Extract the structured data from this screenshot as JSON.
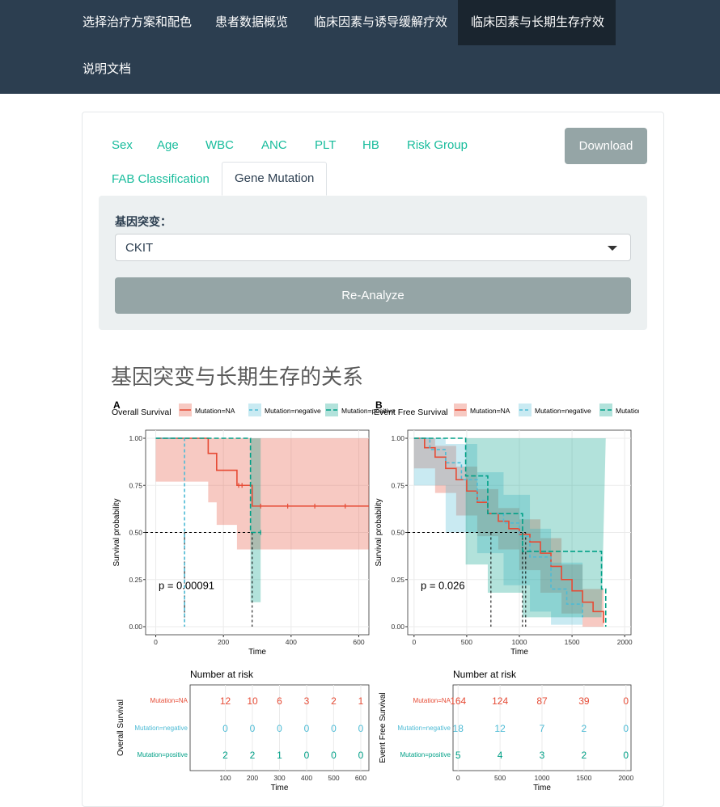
{
  "nav": {
    "items": [
      {
        "label": "选择治疗方案和配色"
      },
      {
        "label": "患者数据概览"
      },
      {
        "label": "临床因素与诱导缓解疗效"
      },
      {
        "label": "临床因素与长期生存疗效"
      },
      {
        "label": "说明文档"
      }
    ],
    "active_index": 3
  },
  "tabs": [
    {
      "label": "Sex"
    },
    {
      "label": "Age"
    },
    {
      "label": "WBC"
    },
    {
      "label": "ANC"
    },
    {
      "label": "PLT"
    },
    {
      "label": "HB"
    },
    {
      "label": "Risk Group"
    },
    {
      "label": "FAB Classification"
    },
    {
      "label": "Gene Mutation"
    }
  ],
  "active_tab": "Gene Mutation",
  "download_label": "Download",
  "form": {
    "gene_label": "基因突变：",
    "gene_selected": "CKIT",
    "reanalyze_label": "Re-Analyze"
  },
  "section_title": "基因突变与长期生存的关系",
  "colors": {
    "navbar": "#2c3e50",
    "accent": "#18bc9c",
    "button": "#95a5a6",
    "well": "#ecf0f1",
    "na": "#e64b35",
    "negative": "#4dbbd5",
    "positive": "#00a087"
  },
  "chart_data": [
    {
      "type": "line",
      "panel_label": "A",
      "title": "Overall Survival",
      "legend": [
        "Mutation=NA",
        "Mutation=negative",
        "Mutation=positive"
      ],
      "legend_position": "top",
      "xlabel": "Time",
      "ylabel": "Survival probability",
      "xlim": [
        -30,
        630
      ],
      "ylim": [
        0,
        1
      ],
      "x_ticks": [
        0,
        200,
        400,
        600
      ],
      "y_ticks": [
        0.0,
        0.25,
        0.5,
        0.75,
        1.0
      ],
      "y_tick_labels": [
        "0.00",
        "0.25",
        "0.50",
        "0.75",
        "1.00"
      ],
      "pvalue": "p = 0.00091",
      "median_lines": [
        85,
        285
      ],
      "series": [
        {
          "name": "Mutation=NA",
          "steps": [
            [
              0,
              1.0
            ],
            [
              155,
              0.92
            ],
            [
              180,
              0.83
            ],
            [
              240,
              0.75
            ],
            [
              285,
              0.64
            ],
            [
              630,
              0.64
            ]
          ],
          "ci_lower": [
            [
              0,
              1.0
            ],
            [
              155,
              0.77
            ],
            [
              180,
              0.66
            ],
            [
              240,
              0.54
            ],
            [
              285,
              0.41
            ],
            [
              630,
              0.41
            ]
          ],
          "ci_upper": [
            [
              0,
              1.0
            ],
            [
              630,
              1.0
            ]
          ],
          "censor": [
            [
              245,
              0.75
            ],
            [
              255,
              0.75
            ],
            [
              310,
              0.64
            ],
            [
              390,
              0.64
            ],
            [
              470,
              0.64
            ],
            [
              560,
              0.64
            ]
          ]
        },
        {
          "name": "Mutation=negative",
          "steps": [
            [
              0,
              1.0
            ],
            [
              85,
              1.0
            ],
            [
              85,
              0.0
            ]
          ],
          "ci_lower": [],
          "ci_upper": [],
          "censor": []
        },
        {
          "name": "Mutation=positive",
          "steps": [
            [
              0,
              1.0
            ],
            [
              280,
              1.0
            ],
            [
              280,
              0.5
            ],
            [
              310,
              0.5
            ]
          ],
          "ci_lower": [
            [
              280,
              0.13
            ],
            [
              310,
              0.13
            ]
          ],
          "ci_upper": [
            [
              280,
              1.0
            ],
            [
              310,
              1.0
            ]
          ],
          "censor": [
            [
              310,
              0.5
            ]
          ]
        }
      ],
      "risk_table": {
        "title": "Number at risk",
        "ylabel": "Overall Survival",
        "x_ticks": [
          100,
          200,
          300,
          400,
          500,
          600
        ],
        "xlabel": "Time",
        "rows": [
          {
            "name": "Mutation=NA",
            "values": [
              12,
              10,
              6,
              3,
              2,
              1
            ]
          },
          {
            "name": "Mutation=negative",
            "values": [
              0,
              0,
              0,
              0,
              0,
              0
            ]
          },
          {
            "name": "Mutation=positive",
            "values": [
              2,
              2,
              1,
              0,
              0,
              0
            ]
          }
        ]
      }
    },
    {
      "type": "line",
      "panel_label": "B",
      "title": "Event Free Survival",
      "legend": [
        "Mutation=NA",
        "Mutation=negative",
        "Mutation=positive"
      ],
      "legend_position": "top",
      "xlabel": "Time",
      "ylabel": "Survival probability",
      "xlim": [
        -60,
        2060
      ],
      "ylim": [
        0,
        1
      ],
      "x_ticks": [
        0,
        500,
        1000,
        1500,
        2000
      ],
      "y_ticks": [
        0.0,
        0.25,
        0.5,
        0.75,
        1.0
      ],
      "y_tick_labels": [
        "0.00",
        "0.25",
        "0.50",
        "0.75",
        "1.00"
      ],
      "pvalue": "p = 0.026",
      "median_lines": [
        730,
        1030,
        1060
      ],
      "series": [
        {
          "name": "Mutation=NA",
          "steps": [
            [
              0,
              1.0
            ],
            [
              100,
              0.95
            ],
            [
              200,
              0.9
            ],
            [
              300,
              0.84
            ],
            [
              400,
              0.78
            ],
            [
              500,
              0.72
            ],
            [
              600,
              0.66
            ],
            [
              700,
              0.6
            ],
            [
              800,
              0.56
            ],
            [
              900,
              0.52
            ],
            [
              1000,
              0.49
            ],
            [
              1100,
              0.45
            ],
            [
              1200,
              0.39
            ],
            [
              1300,
              0.32
            ],
            [
              1400,
              0.25
            ],
            [
              1500,
              0.19
            ],
            [
              1600,
              0.13
            ],
            [
              1700,
              0.08
            ],
            [
              1800,
              0.02
            ]
          ],
          "ci_lower": [
            [
              0,
              1.0
            ],
            [
              200,
              0.84
            ],
            [
              400,
              0.71
            ],
            [
              600,
              0.59
            ],
            [
              800,
              0.48
            ],
            [
              1000,
              0.41
            ],
            [
              1200,
              0.3
            ],
            [
              1400,
              0.18
            ],
            [
              1600,
              0.07
            ],
            [
              1800,
              0.0
            ]
          ],
          "ci_upper": [
            [
              0,
              1.0
            ],
            [
              200,
              0.96
            ],
            [
              400,
              0.85
            ],
            [
              600,
              0.73
            ],
            [
              800,
              0.63
            ],
            [
              1000,
              0.57
            ],
            [
              1200,
              0.47
            ],
            [
              1400,
              0.33
            ],
            [
              1600,
              0.2
            ],
            [
              1800,
              0.06
            ]
          ],
          "censor": []
        },
        {
          "name": "Mutation=negative",
          "steps": [
            [
              0,
              1.0
            ],
            [
              150,
              0.94
            ],
            [
              300,
              0.87
            ],
            [
              450,
              0.78
            ],
            [
              600,
              0.67
            ],
            [
              700,
              0.6
            ],
            [
              850,
              0.55
            ],
            [
              1000,
              0.48
            ],
            [
              1100,
              0.37
            ],
            [
              1300,
              0.2
            ],
            [
              1450,
              0.12
            ],
            [
              1600,
              0.05
            ]
          ],
          "ci_lower": [
            [
              0,
              1.0
            ],
            [
              300,
              0.75
            ],
            [
              600,
              0.5
            ],
            [
              850,
              0.39
            ],
            [
              1100,
              0.22
            ],
            [
              1300,
              0.08
            ],
            [
              1600,
              0.01
            ]
          ],
          "ci_upper": [
            [
              0,
              1.0
            ],
            [
              300,
              0.97
            ],
            [
              600,
              0.82
            ],
            [
              850,
              0.7
            ],
            [
              1100,
              0.52
            ],
            [
              1300,
              0.34
            ],
            [
              1600,
              0.12
            ]
          ],
          "censor": []
        },
        {
          "name": "Mutation=positive",
          "steps": [
            [
              0,
              1.0
            ],
            [
              490,
              1.0
            ],
            [
              490,
              0.8
            ],
            [
              700,
              0.8
            ],
            [
              700,
              0.6
            ],
            [
              1030,
              0.6
            ],
            [
              1030,
              0.4
            ],
            [
              1780,
              0.4
            ],
            [
              1780,
              0.2
            ],
            [
              1820,
              0.0
            ]
          ],
          "ci_lower": [
            [
              490,
              0.5
            ],
            [
              700,
              0.33
            ],
            [
              1030,
              0.18
            ],
            [
              1780,
              0.05
            ]
          ],
          "ci_upper": [
            [
              490,
              1.0
            ],
            [
              1820,
              1.0
            ]
          ],
          "censor": []
        }
      ],
      "risk_table": {
        "title": "Number at risk",
        "ylabel": "Event Free Survival",
        "x_ticks": [
          0,
          500,
          1000,
          1500,
          2000
        ],
        "xlabel": "Time",
        "rows": [
          {
            "name": "Mutation=NA",
            "values": [
              164,
              124,
              87,
              39,
              0
            ]
          },
          {
            "name": "Mutation=negative",
            "values": [
              18,
              12,
              7,
              2,
              0
            ]
          },
          {
            "name": "Mutation=positive",
            "values": [
              5,
              4,
              3,
              2,
              0
            ]
          }
        ]
      }
    }
  ]
}
